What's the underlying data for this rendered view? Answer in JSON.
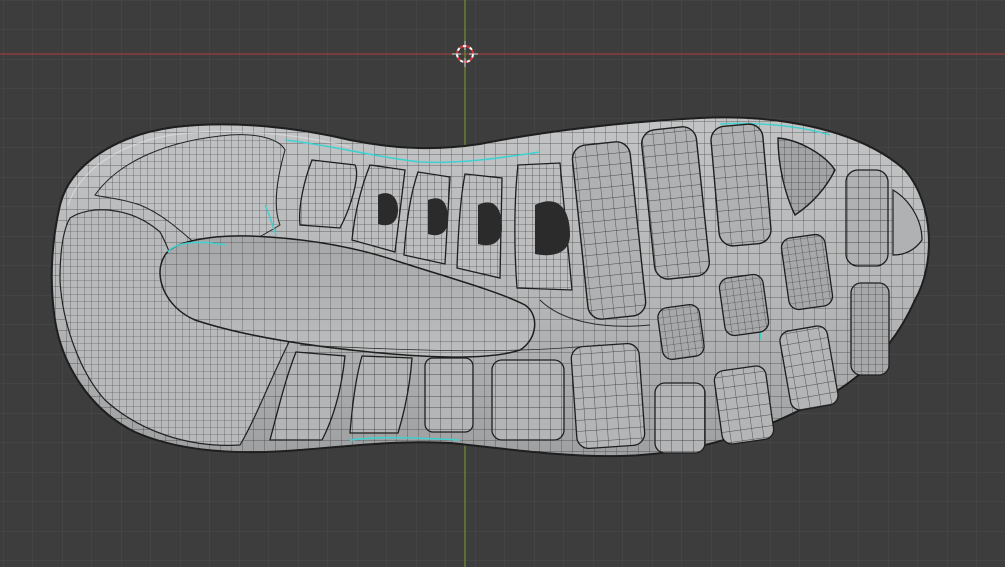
{
  "viewport": {
    "background": "#3d3d3d",
    "grid_color": "#4a4a4a",
    "x_axis_color": "#b33a3a",
    "y_axis_color": "#7a9e2a",
    "wire_color": "#2a2a2a",
    "selection_color": "#3fd0d0",
    "mesh_fill": "#b5b6b7",
    "cursor_icon": "3d-cursor-icon",
    "object": "shoe-outsole-mesh"
  }
}
